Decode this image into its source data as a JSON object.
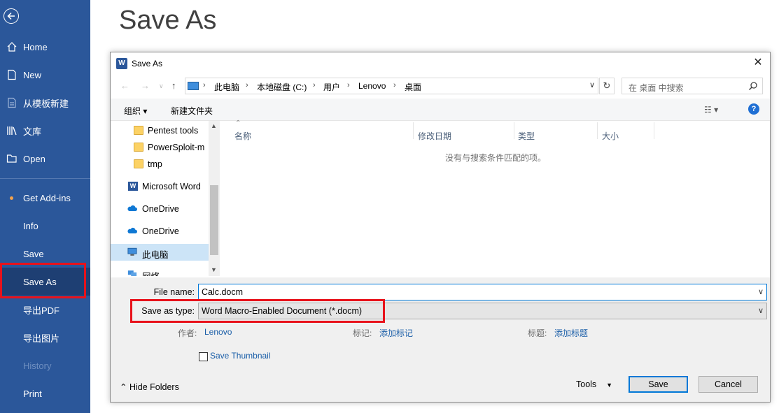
{
  "backstage": {
    "page_title": "Save As",
    "nav": [
      {
        "label": "Home"
      },
      {
        "label": "New"
      },
      {
        "label": "从模板新建"
      },
      {
        "label": "文库"
      },
      {
        "label": "Open"
      },
      {
        "label": "Get Add-ins"
      },
      {
        "label": "Info"
      },
      {
        "label": "Save"
      },
      {
        "label": "Save As"
      },
      {
        "label": "导出PDF"
      },
      {
        "label": "导出图片"
      },
      {
        "label": "History"
      },
      {
        "label": "Print"
      }
    ]
  },
  "dialog": {
    "title": "Save As",
    "breadcrumbs": [
      "此电脑",
      "本地磁盘 (C:)",
      "用户",
      "Lenovo",
      "桌面"
    ],
    "search_placeholder": "在 桌面 中搜索",
    "toolbar": {
      "organize": "组织 ▾",
      "new_folder": "新建文件夹"
    },
    "tree": [
      {
        "label": "Pentest tools",
        "icon": "folder-icon"
      },
      {
        "label": "PowerSploit-m",
        "icon": "folder-icon"
      },
      {
        "label": "tmp",
        "icon": "folder-icon"
      },
      {
        "label": "Microsoft Word",
        "icon": "word-icon"
      },
      {
        "label": "OneDrive",
        "icon": "onedrive-icon"
      },
      {
        "label": "OneDrive",
        "icon": "onedrive-icon"
      },
      {
        "label": "此电脑",
        "icon": "computer-icon"
      },
      {
        "label": "网络",
        "icon": "network-icon"
      }
    ],
    "columns": [
      "名称",
      "修改日期",
      "类型",
      "大小"
    ],
    "empty_message": "没有与搜索条件匹配的项。",
    "file_name_label": "File name:",
    "file_name_value": "Calc.docm",
    "save_type_label": "Save as type:",
    "save_type_value": "Word Macro-Enabled Document (*.docm)",
    "author_label": "作者:",
    "author_value": "Lenovo",
    "tags_label": "标记:",
    "tags_value": "添加标记",
    "title_label": "标题:",
    "title_value": "添加标题",
    "save_thumbnail": "Save Thumbnail",
    "hide_folders": "Hide Folders",
    "tools": "Tools",
    "save": "Save",
    "cancel": "Cancel"
  },
  "colors": {
    "sidebar": "#2b579a",
    "highlight": "#e8121b",
    "accent": "#0078d7"
  }
}
